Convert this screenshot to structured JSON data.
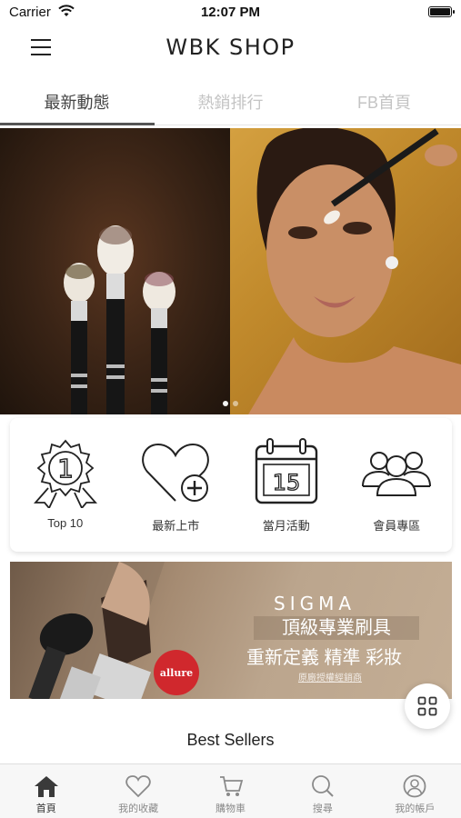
{
  "status_bar": {
    "carrier": "Carrier",
    "time": "12:07 PM"
  },
  "nav": {
    "title": "WBK SHOP"
  },
  "tabs": [
    {
      "label": "最新動態",
      "active": true
    },
    {
      "label": "熱銷排行",
      "active": false
    },
    {
      "label": "FB首頁",
      "active": false
    }
  ],
  "carousel": {
    "total_pages": 2,
    "current_page": 1
  },
  "quick_links": [
    {
      "label": "Top 10",
      "icon": "award-ribbon-icon",
      "badge": "1"
    },
    {
      "label": "最新上市",
      "icon": "heart-plus-icon"
    },
    {
      "label": "當月活動",
      "icon": "calendar-icon",
      "badge": "15"
    },
    {
      "label": "會員專區",
      "icon": "members-icon"
    }
  ],
  "promo": {
    "brand": "SIGMA",
    "line1": "頂級專業刷具",
    "line2": "重新定義 精準 彩妝",
    "link": "原廠授權經銷商",
    "badge": "allure"
  },
  "section_title": "Best Sellers",
  "bottom_nav": [
    {
      "label": "首頁",
      "icon": "home-icon",
      "active": true
    },
    {
      "label": "我的收藏",
      "icon": "heart-icon",
      "active": false
    },
    {
      "label": "購物車",
      "icon": "cart-icon",
      "active": false
    },
    {
      "label": "搜尋",
      "icon": "search-icon",
      "active": false
    },
    {
      "label": "我的帳戶",
      "icon": "account-icon",
      "active": false
    }
  ],
  "colors": {
    "active_tab_text": "#444444",
    "inactive_tab_text": "#c4c4c4",
    "bottom_active": "#333333",
    "bottom_inactive": "#8a8a8a"
  }
}
